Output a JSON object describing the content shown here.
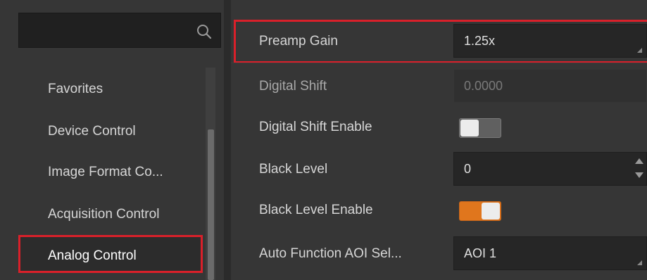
{
  "search": {
    "value": "",
    "placeholder": ""
  },
  "nav": {
    "items": [
      {
        "label": "Favorites"
      },
      {
        "label": "Device Control"
      },
      {
        "label": "Image Format Co..."
      },
      {
        "label": "Acquisition Control"
      },
      {
        "label": "Analog Control",
        "selected": true
      }
    ]
  },
  "properties": {
    "preamp_gain": {
      "label": "Preamp Gain",
      "value": "1.25x"
    },
    "digital_shift": {
      "label": "Digital Shift",
      "value": "0.0000"
    },
    "digital_shift_enable": {
      "label": "Digital Shift Enable",
      "state": "off"
    },
    "black_level": {
      "label": "Black Level",
      "value": "0"
    },
    "black_level_enable": {
      "label": "Black Level Enable",
      "state": "on"
    },
    "auto_function_aoi": {
      "label": "Auto Function AOI Sel...",
      "value": "AOI 1"
    }
  },
  "colors": {
    "highlight": "#d9202a",
    "toggle_on": "#e0761d",
    "toggle_off": "#606060",
    "panel_bg": "#363636",
    "field_bg": "#262626"
  },
  "icons": {
    "search": "search-icon"
  }
}
